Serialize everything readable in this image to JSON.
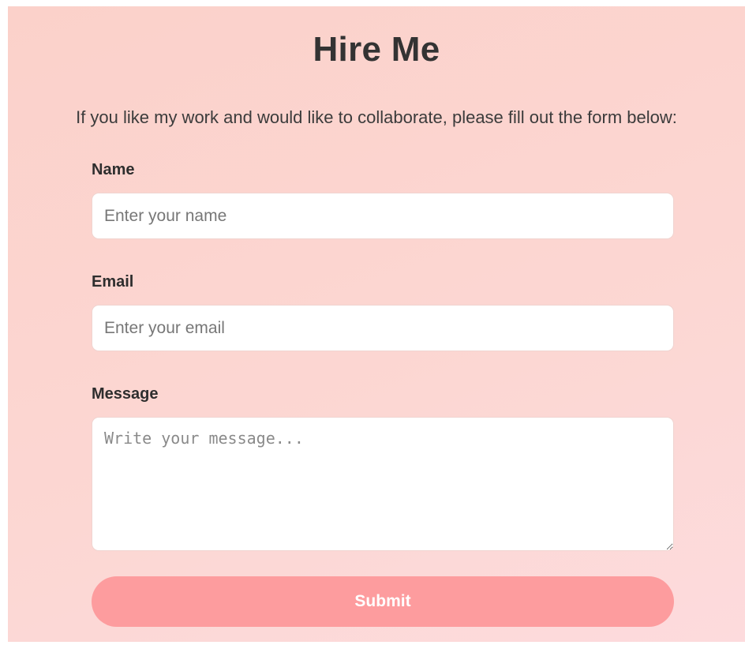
{
  "page": {
    "title": "Hire Me",
    "intro": "If you like my work and would like to collaborate, please fill out the form below:"
  },
  "form": {
    "name": {
      "label": "Name",
      "placeholder": "Enter your name",
      "value": ""
    },
    "email": {
      "label": "Email",
      "placeholder": "Enter your email",
      "value": ""
    },
    "message": {
      "label": "Message",
      "placeholder": "Write your message...",
      "value": ""
    },
    "submit_label": "Submit"
  },
  "colors": {
    "background_gradient": [
      "#fbd1ca",
      "#fddbdd"
    ],
    "submit_button": "#fd9c9e",
    "field_background": "#ffffff",
    "heading_text": "#333333"
  }
}
